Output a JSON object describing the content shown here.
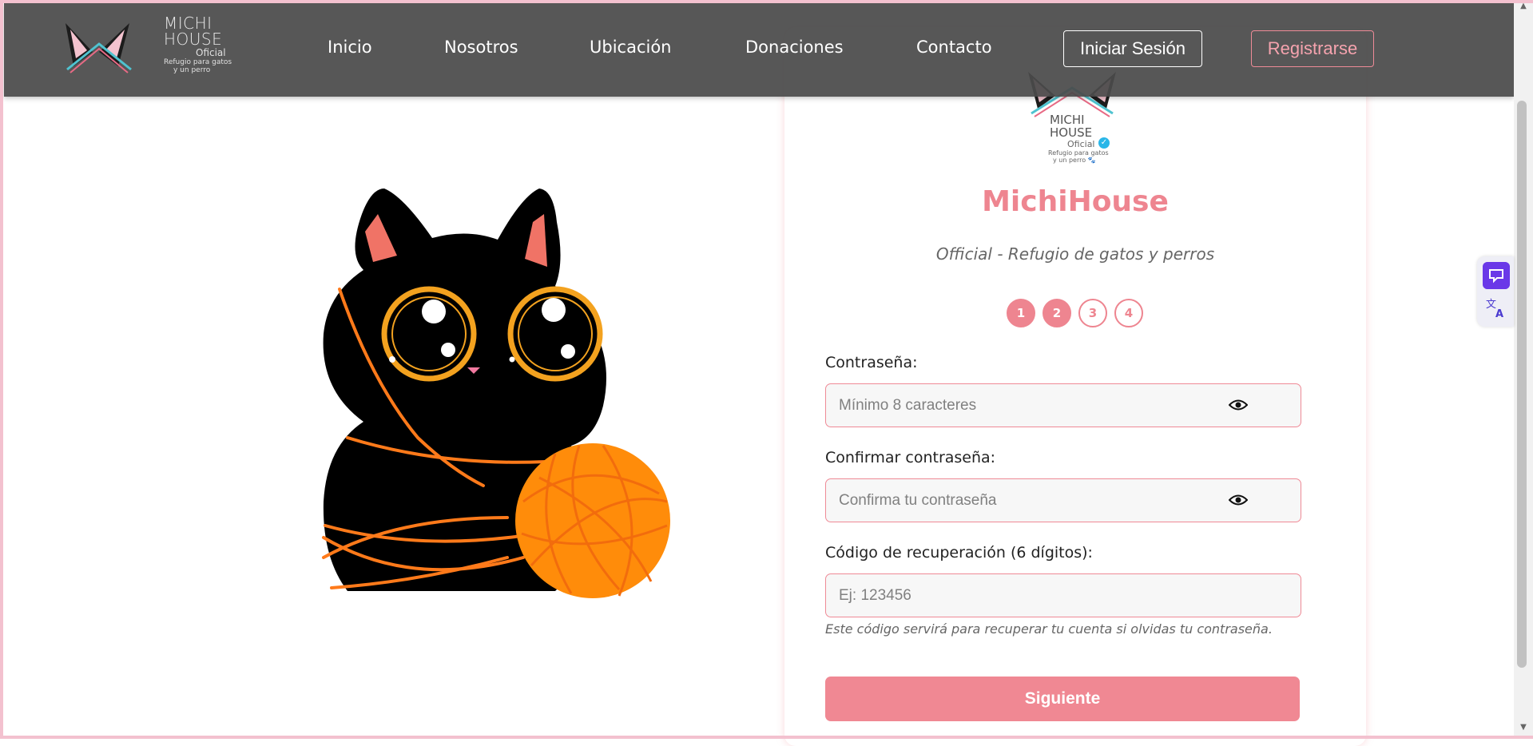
{
  "header": {
    "logo": {
      "line1": "MICHI",
      "line2": "HOUSE",
      "line3": "Oficial",
      "line4": "Refugio para gatos",
      "line5": "y un perro"
    },
    "nav": [
      "Inicio",
      "Nosotros",
      "Ubicación",
      "Donaciones",
      "Contacto"
    ],
    "login_label": "Iniciar Sesión",
    "register_label": "Registrarse"
  },
  "card": {
    "logo": {
      "line1": "MICHI",
      "line2": "HOUSE",
      "line3": "Oficial",
      "line4": "Refugio para gatos",
      "line5": "y un perro 🐾"
    },
    "title": "MichiHouse",
    "subtitle": "Official - Refugio de gatos y perros",
    "steps": [
      "1",
      "2",
      "3",
      "4"
    ],
    "current_step": 2,
    "password": {
      "label": "Contraseña:",
      "placeholder": "Mínimo 8 caracteres",
      "value": ""
    },
    "confirm": {
      "label": "Confirmar contraseña:",
      "placeholder": "Confirma tu contraseña",
      "value": ""
    },
    "code": {
      "label": "Código de recuperación (6 dígitos):",
      "placeholder": "Ej: 123456",
      "value": ""
    },
    "hint": "Este código servirá para recuperar tu cuenta si olvidas tu contraseña.",
    "next_label": "Siguiente"
  },
  "colors": {
    "accent": "#ee8590",
    "header_bg": "#4a4a4a",
    "yarn": "#ff8c00",
    "side_widget": "#6a38e8"
  },
  "icons": [
    "eye-icon",
    "scroll-up-icon",
    "scroll-down-icon",
    "extension-icon",
    "translate-icon"
  ]
}
